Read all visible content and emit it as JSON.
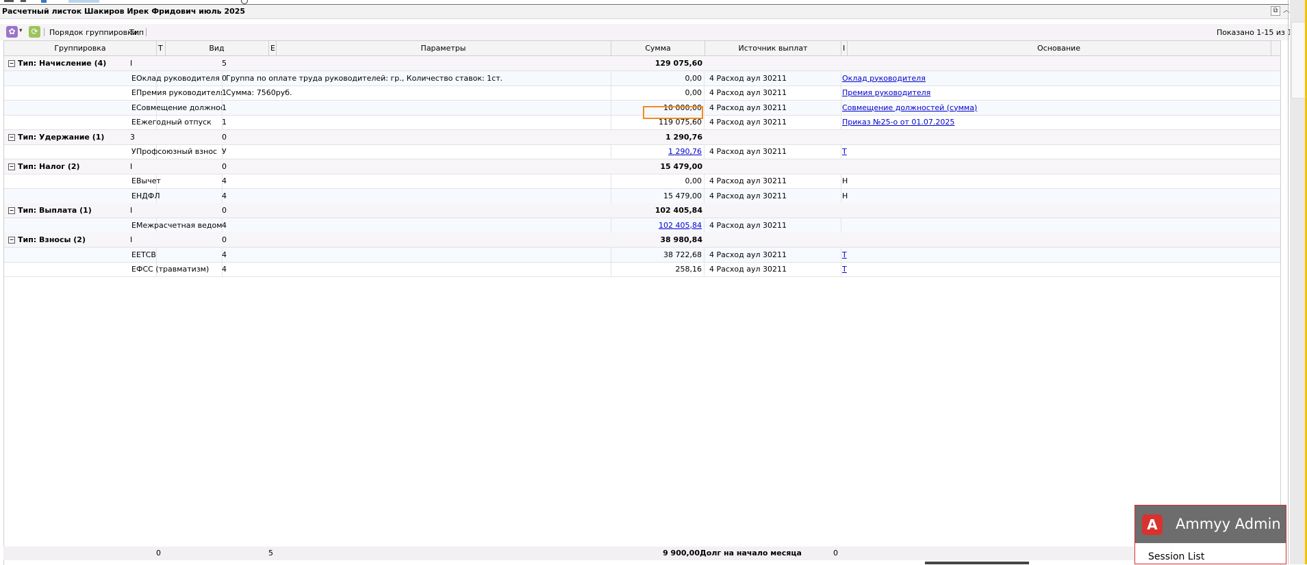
{
  "window": {
    "title": "Расчетный листок Шакиров Ирек Фридович июль 2025",
    "restore_glyph": "⧉",
    "collapse_glyph": "︿"
  },
  "toolbar": {
    "group_label": "Порядок группировки:",
    "group_value": "Тип",
    "shown": "Показано 1-15 из 15"
  },
  "columns": {
    "grouping": "Группировка",
    "c2_frag": "Т",
    "kind": "Вид",
    "c4_frag": "Е",
    "params": "Параметры",
    "sum": "Сумма",
    "source": "Источник выплат",
    "c8_frag": "I",
    "basis": "Основание"
  },
  "groups": [
    {
      "label": "Тип: Начисление (4)",
      "f1": "I",
      "f2": "5",
      "sum": "129 075,60"
    },
    {
      "label": "Тип: Удержание (1)",
      "f1": "3",
      "f2": "0",
      "sum": "1 290,76"
    },
    {
      "label": "Тип: Налог (2)",
      "f1": "I",
      "f2": "0",
      "sum": "15 479,00"
    },
    {
      "label": "Тип: Выплата (1)",
      "f1": "I",
      "f2": "0",
      "sum": "102 405,84"
    },
    {
      "label": "Тип: Взносы (2)",
      "f1": "I",
      "f2": "0",
      "sum": "38 980,84"
    }
  ],
  "rows": [
    {
      "c2": "E",
      "kind": "Оклад руководителя",
      "c4": "0",
      "params": "Группа по оплате труда руководителей: гр., Количество ставок: 1ст.",
      "sum": "0,00",
      "source": "4 Расход аул 30211",
      "basis": "Оклад руководителя"
    },
    {
      "c2": "E",
      "kind": "Премия руководителя",
      "c4": "1",
      "params": "Сумма: 7560руб.",
      "sum": "0,00",
      "source": "4 Расход аул 30211",
      "basis": "Премия руководителя"
    },
    {
      "c2": "E",
      "kind": "Совмещение должностей ...",
      "c4": "1",
      "params": "",
      "sum": "10 000,00",
      "source": "4 Расход аул 30211",
      "basis": "Совмещение должностей (сумма)"
    },
    {
      "c2": "E",
      "kind": "Ежегодный отпуск",
      "c4": "1",
      "params": "",
      "sum": "119 075,60",
      "source": "4 Расход аул 30211",
      "basis": "Приказ №25-о от 01.07.2025"
    },
    {
      "c2": "У",
      "kind": "Профсоюзный взнос",
      "c4": "У",
      "params": "",
      "sum": "1 290,76",
      "source": "4 Расход аул 30211",
      "basis": "Т"
    },
    {
      "c2": "E",
      "kind": "Вычет",
      "c4": "4",
      "params": "",
      "sum": "0,00",
      "source": "4 Расход аул 30211",
      "basis": "Н"
    },
    {
      "c2": "E",
      "kind": "НДФЛ",
      "c4": "4",
      "params": "",
      "sum": "15 479,00",
      "source": "4 Расход аул 30211",
      "basis": "Н"
    },
    {
      "c2": "E",
      "kind": "Межрасчетная ведомость ...",
      "c4": "4",
      "params": "",
      "sum": "102 405,84",
      "source": "4 Расход аул 30211",
      "basis": ""
    },
    {
      "c2": "E",
      "kind": "ЕТСВ",
      "c4": "4",
      "params": "",
      "sum": "38 722,68",
      "source": "4 Расход аул 30211",
      "basis": "Т"
    },
    {
      "c2": "E",
      "kind": "ФСС (травматизм)",
      "c4": "4",
      "params": "",
      "sum": "258,16",
      "source": "4 Расход аул 30211",
      "basis": "Т"
    }
  ],
  "footer": {
    "f1": "0",
    "f2": "5",
    "sum": "9 900,00",
    "label": "Долг на начало месяца",
    "f3": "0"
  },
  "ammyy": {
    "logo": "A",
    "title": "Ammyy Admin",
    "session_list": "Session List"
  },
  "colors": {
    "highlight": "#f28a1e",
    "link": "#0000cc",
    "ammyy_red": "#d8322e"
  }
}
